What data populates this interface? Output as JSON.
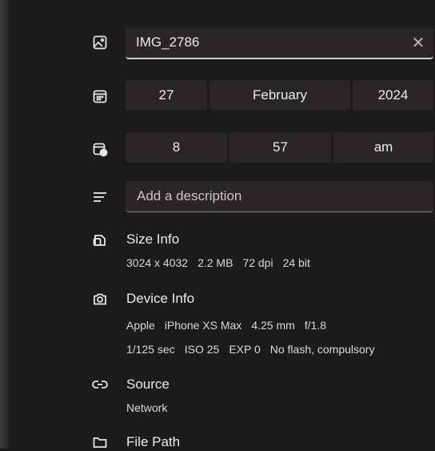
{
  "title_field": {
    "value": "IMG_2786",
    "clear_icon": "close-icon"
  },
  "date": {
    "day": "27",
    "month": "February",
    "year": "2024"
  },
  "time": {
    "hour": "8",
    "minute": "57",
    "ampm": "am"
  },
  "description": {
    "placeholder": "Add a description"
  },
  "size_info": {
    "title": "Size Info",
    "values": [
      "3024 x 4032",
      "2.2 MB",
      "72 dpi",
      "24 bit"
    ]
  },
  "device_info": {
    "title": "Device Info",
    "line1": [
      "Apple",
      "iPhone XS Max",
      "4.25 mm",
      "f/1.8"
    ],
    "line2": [
      "1/125 sec",
      "ISO 25",
      "EXP 0",
      "No flash, compulsory"
    ]
  },
  "source": {
    "title": "Source",
    "value": "Network"
  },
  "file_path": {
    "title": "File Path"
  },
  "icons": [
    "image-icon",
    "calendar-icon",
    "clock-icon",
    "description-icon",
    "size-icon",
    "camera-icon",
    "link-icon",
    "folder-icon"
  ]
}
